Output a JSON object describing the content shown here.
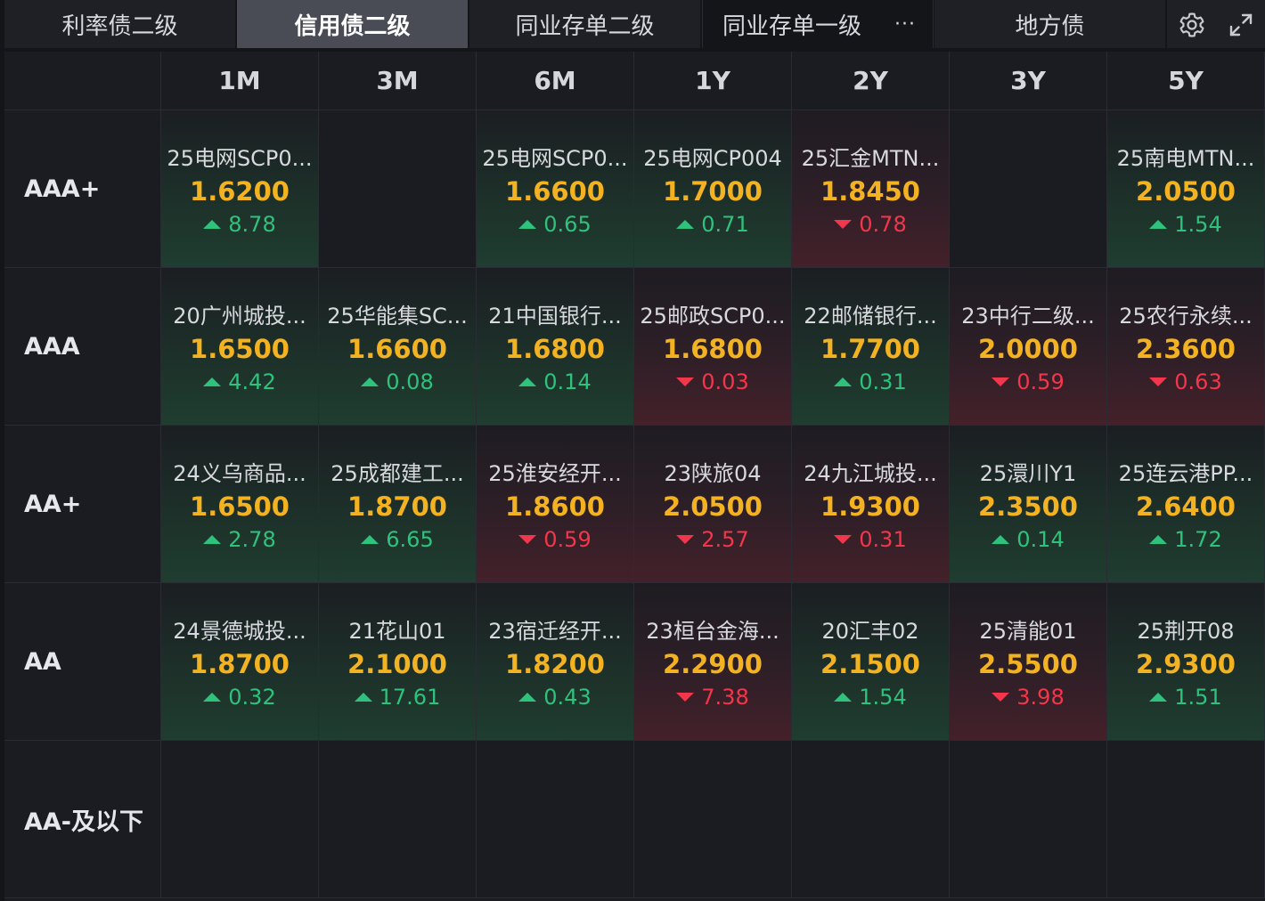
{
  "tabs": [
    {
      "label": "利率债二级",
      "state": "normal"
    },
    {
      "label": "信用债二级",
      "state": "active"
    },
    {
      "label": "同业存单二级",
      "state": "normal"
    },
    {
      "label": "同业存单一级",
      "state": "selected"
    },
    {
      "label": "地方债",
      "state": "normal"
    }
  ],
  "toolbar": {
    "more_icon": "more-horizontal-icon",
    "more_label": "···",
    "settings_icon": "gear-icon",
    "fullscreen_icon": "expand-icon"
  },
  "colors": {
    "rate": "#f3b221",
    "up": "#2fc27c",
    "down": "#f2364b",
    "active_tab": "#4a4c55"
  },
  "grid": {
    "columns": [
      "1M",
      "3M",
      "6M",
      "1Y",
      "2Y",
      "3Y",
      "5Y"
    ],
    "rows": [
      {
        "rating": "AAA+",
        "cells": [
          {
            "name": "25电网SCP0...",
            "rate": "1.6200",
            "change": "8.78",
            "dir": "up"
          },
          null,
          {
            "name": "25电网SCP0...",
            "rate": "1.6600",
            "change": "0.65",
            "dir": "up"
          },
          {
            "name": "25电网CP004",
            "rate": "1.7000",
            "change": "0.71",
            "dir": "up"
          },
          {
            "name": "25汇金MTN...",
            "rate": "1.8450",
            "change": "0.78",
            "dir": "down"
          },
          null,
          {
            "name": "25南电MTN...",
            "rate": "2.0500",
            "change": "1.54",
            "dir": "up"
          }
        ]
      },
      {
        "rating": "AAA",
        "cells": [
          {
            "name": "20广州城投...",
            "rate": "1.6500",
            "change": "4.42",
            "dir": "up"
          },
          {
            "name": "25华能集SC...",
            "rate": "1.6600",
            "change": "0.08",
            "dir": "up"
          },
          {
            "name": "21中国银行...",
            "rate": "1.6800",
            "change": "0.14",
            "dir": "up"
          },
          {
            "name": "25邮政SCP0...",
            "rate": "1.6800",
            "change": "0.03",
            "dir": "down"
          },
          {
            "name": "22邮储银行...",
            "rate": "1.7700",
            "change": "0.31",
            "dir": "up"
          },
          {
            "name": "23中行二级...",
            "rate": "2.0000",
            "change": "0.59",
            "dir": "down"
          },
          {
            "name": "25农行永续...",
            "rate": "2.3600",
            "change": "0.63",
            "dir": "down"
          }
        ]
      },
      {
        "rating": "AA+",
        "cells": [
          {
            "name": "24义乌商品...",
            "rate": "1.6500",
            "change": "2.78",
            "dir": "up"
          },
          {
            "name": "25成都建工...",
            "rate": "1.8700",
            "change": "6.65",
            "dir": "up"
          },
          {
            "name": "25淮安经开...",
            "rate": "1.8600",
            "change": "0.59",
            "dir": "down"
          },
          {
            "name": "23陕旅04",
            "rate": "2.0500",
            "change": "2.57",
            "dir": "down"
          },
          {
            "name": "24九江城投...",
            "rate": "1.9300",
            "change": "0.31",
            "dir": "down"
          },
          {
            "name": "25澴川Y1",
            "rate": "2.3500",
            "change": "0.14",
            "dir": "up"
          },
          {
            "name": "25连云港PP...",
            "rate": "2.6400",
            "change": "1.72",
            "dir": "up"
          }
        ]
      },
      {
        "rating": "AA",
        "cells": [
          {
            "name": "24景德城投...",
            "rate": "1.8700",
            "change": "0.32",
            "dir": "up"
          },
          {
            "name": "21花山01",
            "rate": "2.1000",
            "change": "17.61",
            "dir": "up"
          },
          {
            "name": "23宿迁经开...",
            "rate": "1.8200",
            "change": "0.43",
            "dir": "up"
          },
          {
            "name": "23桓台金海...",
            "rate": "2.2900",
            "change": "7.38",
            "dir": "down"
          },
          {
            "name": "20汇丰02",
            "rate": "2.1500",
            "change": "1.54",
            "dir": "up"
          },
          {
            "name": "25清能01",
            "rate": "2.5500",
            "change": "3.98",
            "dir": "down"
          },
          {
            "name": "25荆开08",
            "rate": "2.9300",
            "change": "1.51",
            "dir": "up"
          }
        ]
      },
      {
        "rating": "AA-及以下",
        "cells": [
          null,
          null,
          null,
          null,
          null,
          null,
          null
        ]
      }
    ]
  }
}
